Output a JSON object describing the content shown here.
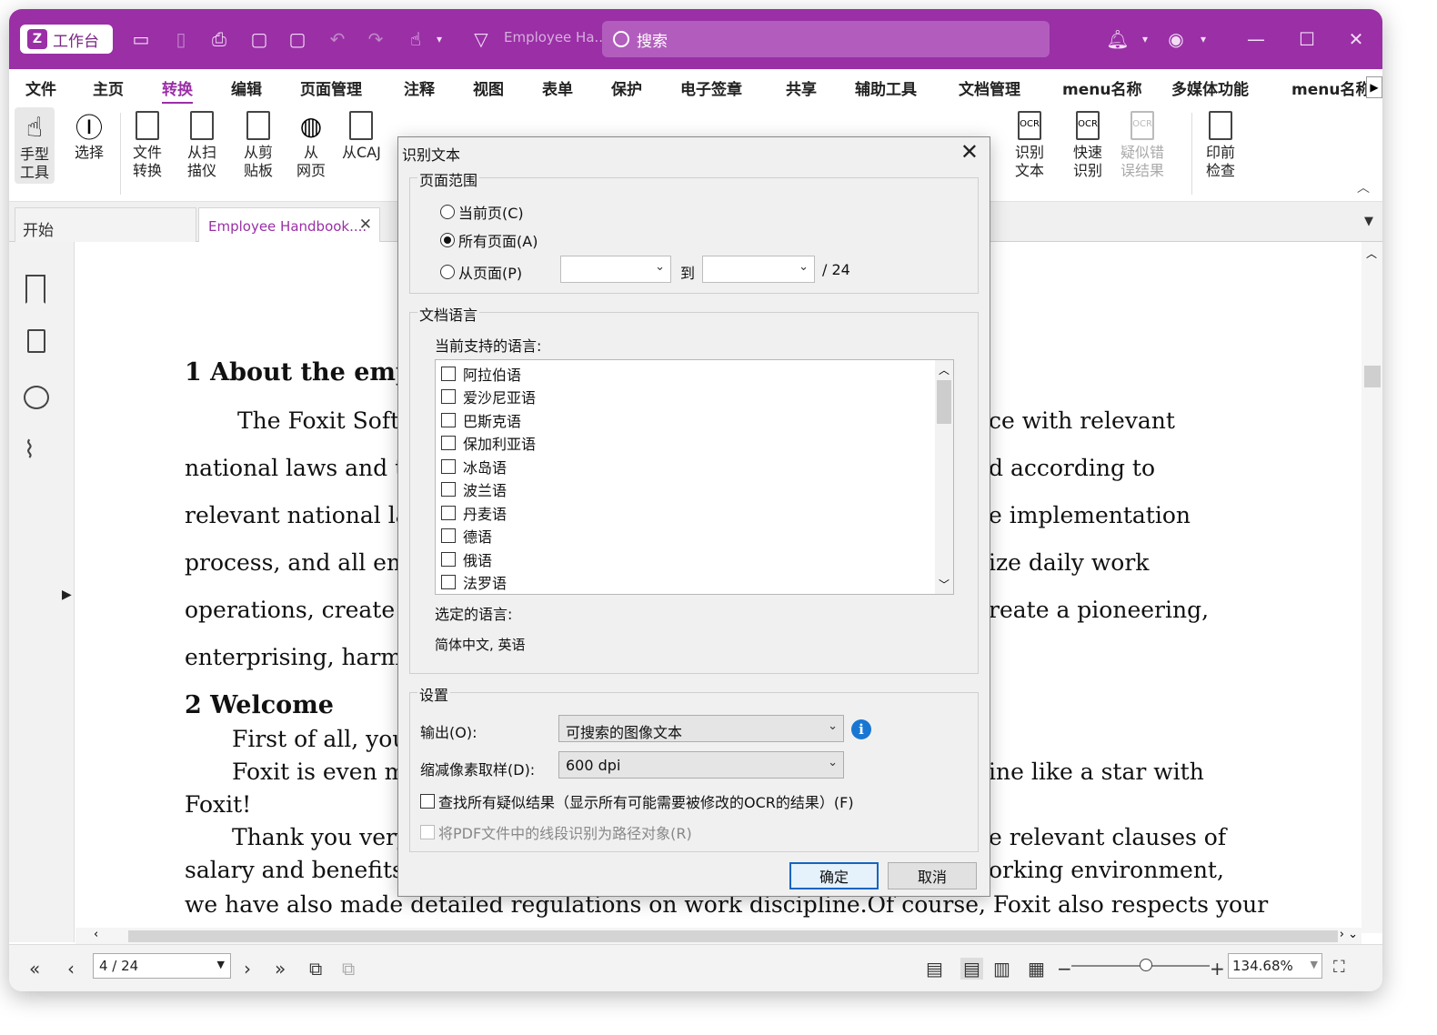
{
  "titlebar": {
    "workspace_label": "工作台",
    "doc_title": "Employee Ha...",
    "search_placeholder": "搜索"
  },
  "menu": {
    "items": [
      "文件",
      "主页",
      "转换",
      "编辑",
      "页面管理",
      "注释",
      "视图",
      "表单",
      "保护",
      "电子签章",
      "共享",
      "辅助工具",
      "文档管理",
      "menu名称",
      "多媒体功能",
      "menu名称"
    ],
    "active": "转换"
  },
  "ribbon": {
    "hand": "手型\n工具",
    "select": "选择",
    "file_convert": "文件\n转换",
    "from_scanner": "从扫\n描仪",
    "from_clipboard": "从剪\n贴板",
    "from_web": "从\n网页",
    "from_caj": "从CAJ",
    "ocr_text": "识别\n文本",
    "quick_ocr": "快速\n识别",
    "suspect_results": "疑似错\n误结果",
    "preflight": "印前\n检查"
  },
  "tabs": {
    "start": "开始",
    "document": "Employee Handbook...."
  },
  "document": {
    "h1": "1   About the empl",
    "p1": "The Foxit Soft",
    "p1r": "ce with relevant",
    "p2": "national laws and t",
    "p2r": "d according to",
    "p3": "relevant national la",
    "p3r": "e implementation",
    "p4": "process, and all em",
    "p4r": "ize daily work",
    "p5": "operations, create a",
    "p5r": "reate a pioneering,",
    "p6": "enterprising, harm",
    "h2": "2   Welcome",
    "p7": "First of all, you",
    "p8": "Foxit is even m",
    "p8r": "ine like a star with",
    "p9": "Foxit!",
    "p10": "Thank you very",
    "p10r": "e relevant clauses of",
    "p11": "salary and benefits",
    "p11r": "orking environment,",
    "p12": "we have also made detailed regulations on work discipline.Of course, Foxit also respects your"
  },
  "dialog": {
    "title": "识别文本",
    "page_range": {
      "label": "页面范围",
      "current": "当前页(C)",
      "all": "所有页面(A)",
      "from": "从页面(P)",
      "to": "到",
      "total": "/ 24",
      "selected": "all"
    },
    "language": {
      "label": "文档语言",
      "supported_label": "当前支持的语言:",
      "items": [
        "阿拉伯语",
        "爱沙尼亚语",
        "巴斯克语",
        "保加利亚语",
        "冰岛语",
        "波兰语",
        "丹麦语",
        "德语",
        "俄语",
        "法罗语"
      ],
      "selected_label": "选定的语言:",
      "selected_value": "简体中文, 英语"
    },
    "settings": {
      "label": "设置",
      "output_label": "输出(O):",
      "output_value": "可搜索的图像文本",
      "downsample_label": "缩减像素取样(D):",
      "downsample_value": "600 dpi",
      "find_suspects": "查找所有疑似结果（显示所有可能需要被修改的OCR的结果）(F)",
      "line_paths": "将PDF文件中的线段识别为路径对象(R)"
    },
    "ok": "确定",
    "cancel": "取消"
  },
  "status": {
    "page": "4 / 24",
    "zoom": "134.68%"
  }
}
